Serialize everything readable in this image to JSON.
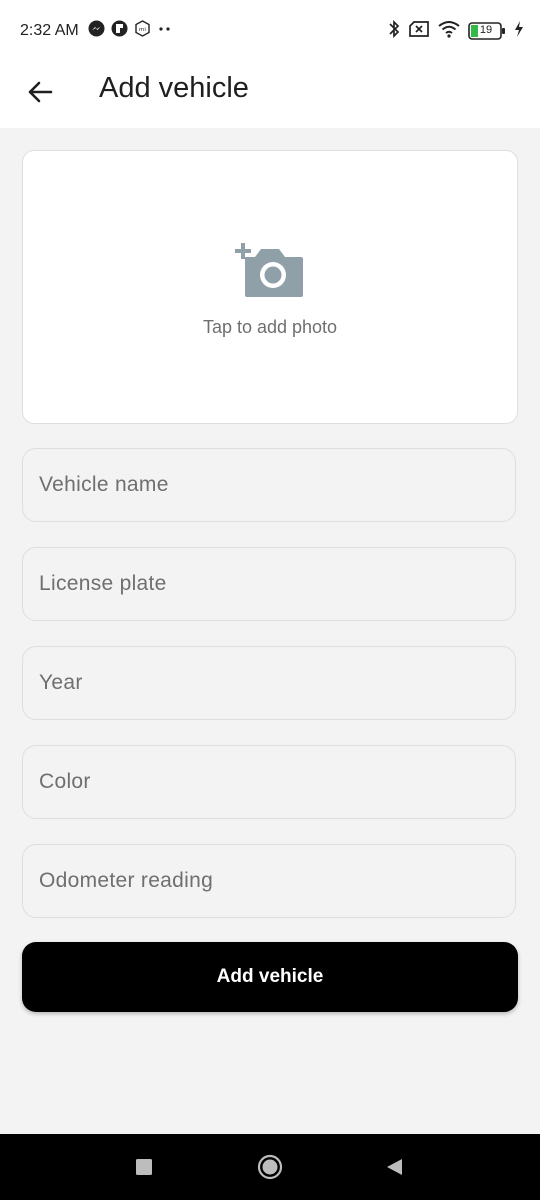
{
  "status_bar": {
    "time": "2:32 AM",
    "battery_level": "19",
    "left_icons": [
      "messenger-icon",
      "app-icon",
      "mi-icon",
      "more-dots-icon"
    ],
    "right_icons": [
      "bluetooth-icon",
      "no-sim-icon",
      "wifi-icon",
      "battery-icon",
      "charging-icon"
    ]
  },
  "app_bar": {
    "title": "Add vehicle",
    "back_icon": "arrow-left-icon"
  },
  "photo_picker": {
    "icon": "add-photo-icon",
    "label": "Tap to add photo"
  },
  "form": {
    "fields": [
      {
        "name": "vehicle-name",
        "placeholder": "Vehicle name"
      },
      {
        "name": "license-plate",
        "placeholder": "License plate"
      },
      {
        "name": "year",
        "placeholder": "Year"
      },
      {
        "name": "color",
        "placeholder": "Color"
      },
      {
        "name": "odometer-reading",
        "placeholder": "Odometer reading"
      }
    ],
    "submit_label": "Add vehicle"
  },
  "colors": {
    "background": "#f3f3f3",
    "surface": "#ffffff",
    "button": "#000000",
    "hint_text": "#6f6f6f",
    "icon_gray": "#90a0a8"
  },
  "nav_bar": {
    "icons": [
      "recents-square-icon",
      "home-circle-icon",
      "back-triangle-icon"
    ]
  }
}
